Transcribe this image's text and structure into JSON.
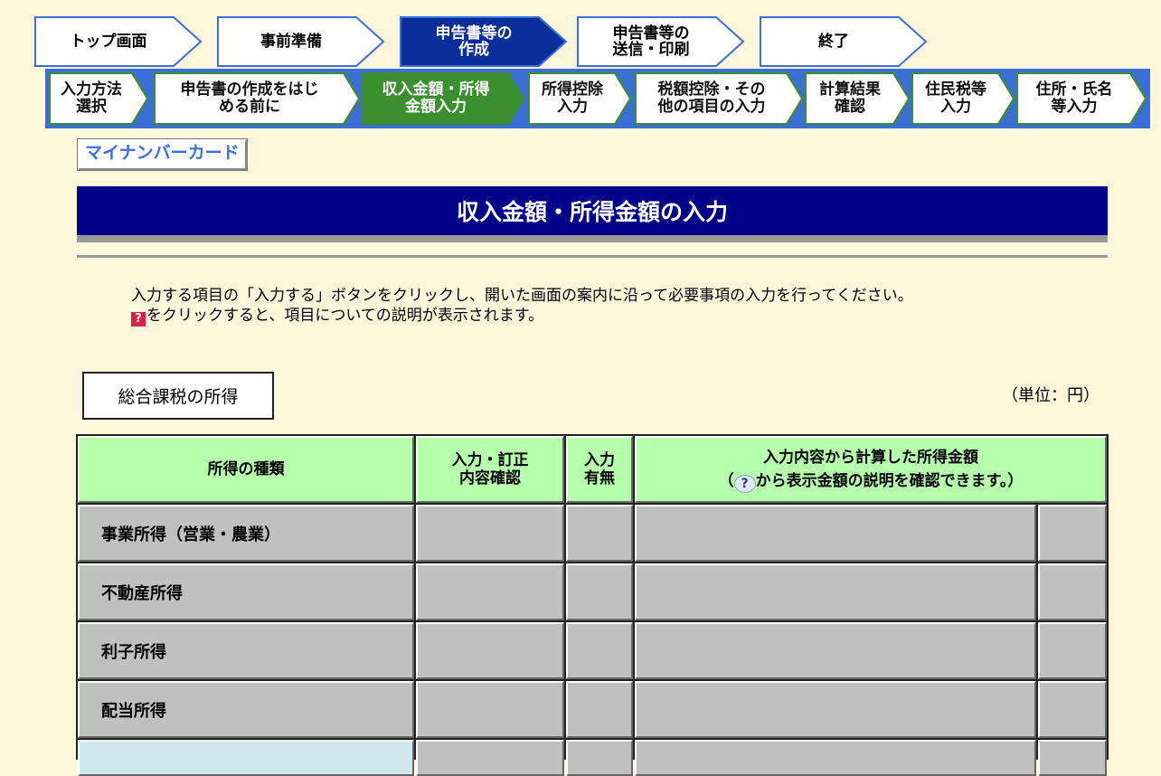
{
  "steps_main": [
    "トップ画面",
    "事前準備",
    "申告書等の\n作成",
    "申告書等の\n送信・印刷",
    "終了"
  ],
  "steps_main_active": 2,
  "steps_sub": [
    "入力方法\n選択",
    "申告書の作成をはじ\nめる前に",
    "収入金額・所得\n金額入力",
    "所得控除\n入力",
    "税額控除・その\n他の項目の入力",
    "計算結果\n確認",
    "住民税等\n入力",
    "住所・氏名\n等入力"
  ],
  "steps_sub_active": 2,
  "mynumber_link": "マイナンバーカード",
  "page_title": "収入金額・所得金額の入力",
  "instructions": {
    "line1": "入力する項目の「入力する」ボタンをクリックし、開いた画面の案内に沿って必要事項の入力を行ってください。",
    "help_glyph": "?",
    "line2": "をクリックすると、項目についての説明が表示されます。"
  },
  "section_label": "総合課税の所得",
  "unit_label": "（単位：円）",
  "table": {
    "headers": {
      "type": "所得の種類",
      "confirm": "入力・訂正\n内容確認",
      "has_input": "入力\n有無",
      "amount_line1": "入力内容から計算した所得金額",
      "amount_pre": "（",
      "amount_glyph": "?",
      "amount_post": "から表示金額の説明を確認できます。）"
    },
    "rows": [
      "事業所得（営業・農業）",
      "不動産所得",
      "利子所得",
      "配当所得"
    ]
  },
  "colors": {
    "title_bg": "#00008b",
    "header_bg": "#b6ffac",
    "active_step": "#0a2f9a",
    "active_substep": "#3a8f2e"
  }
}
